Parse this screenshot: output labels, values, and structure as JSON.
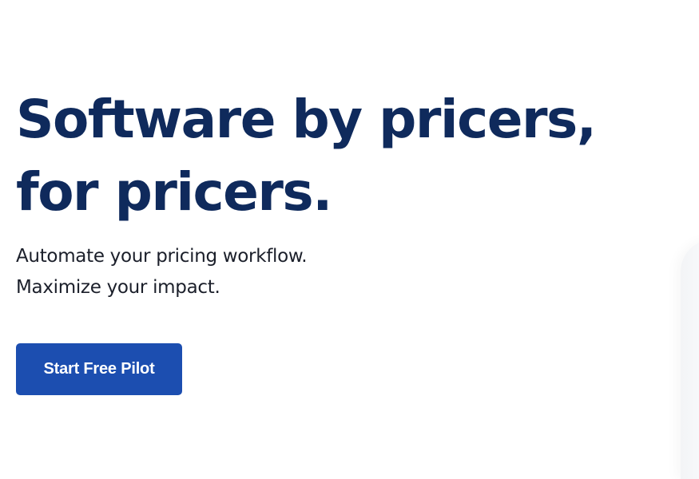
{
  "hero": {
    "headline_line1": "Software by pricers,",
    "headline_line2": "for pricers.",
    "subtext_line1": "Automate your pricing workflow.",
    "subtext_line2": "Maximize your impact.",
    "cta_label": "Start Free Pilot"
  },
  "colors": {
    "headline": "#0f2a5c",
    "body_text": "#1b1f2a",
    "cta_background": "#1c4eb0",
    "cta_text": "#ffffff",
    "page_background": "#ffffff"
  }
}
